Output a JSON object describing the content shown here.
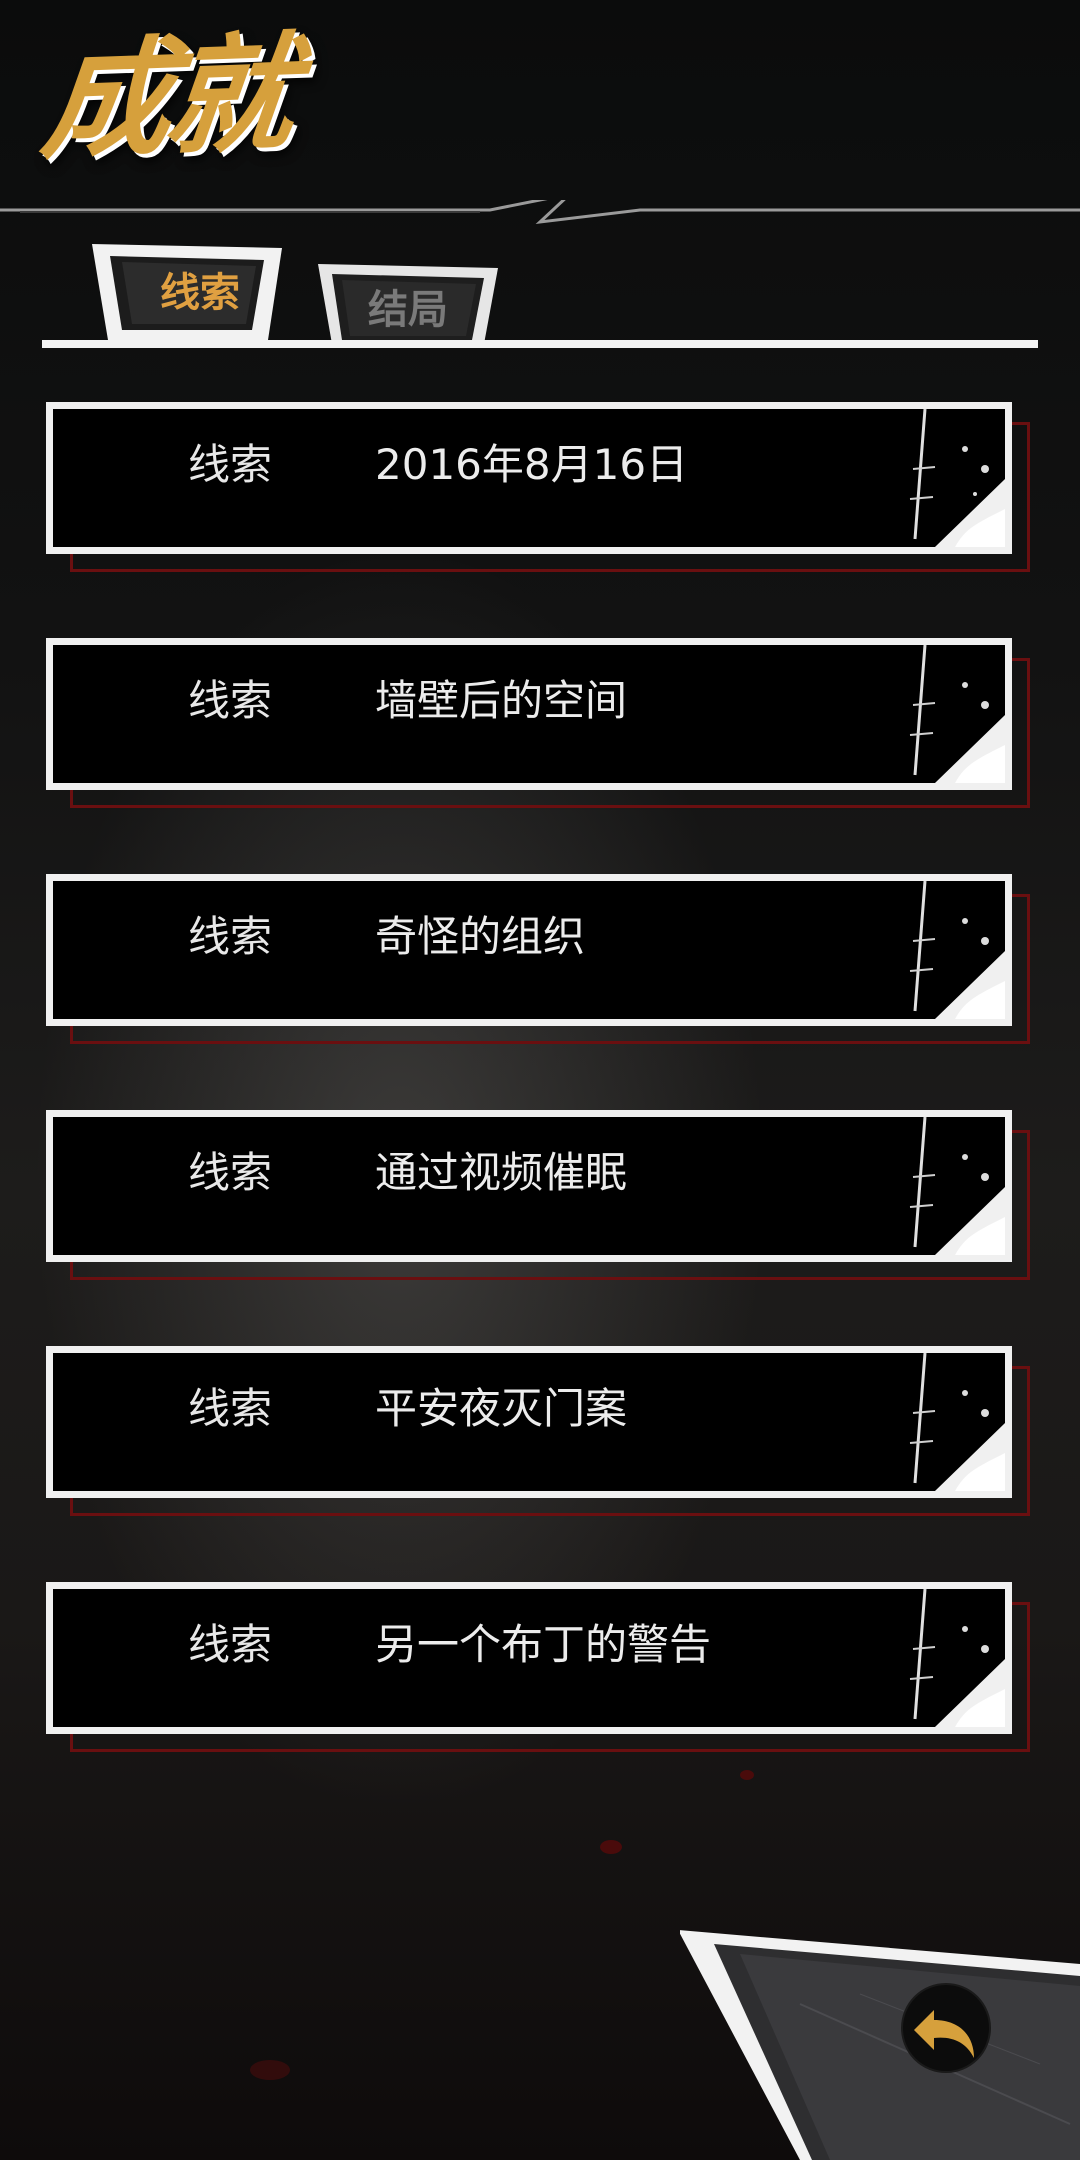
{
  "header": {
    "title": "成就"
  },
  "tabs": [
    {
      "label": "线索",
      "active": true
    },
    {
      "label": "结局",
      "active": false
    }
  ],
  "list": {
    "items": [
      {
        "type": "线索",
        "title": "2016年8月16日"
      },
      {
        "type": "线索",
        "title": "墙壁后的空间"
      },
      {
        "type": "线索",
        "title": "奇怪的组织"
      },
      {
        "type": "线索",
        "title": "通过视频催眠"
      },
      {
        "type": "线索",
        "title": "平安夜灭门案"
      },
      {
        "type": "线索",
        "title": "另一个布丁的警告"
      }
    ]
  },
  "back_button": {
    "icon": "back-arrow-icon"
  },
  "colors": {
    "accent": "#d6a03c",
    "card_border": "#f0f0f0",
    "shadow_frame": "#6a0f10",
    "background": "#0a0a0a"
  }
}
